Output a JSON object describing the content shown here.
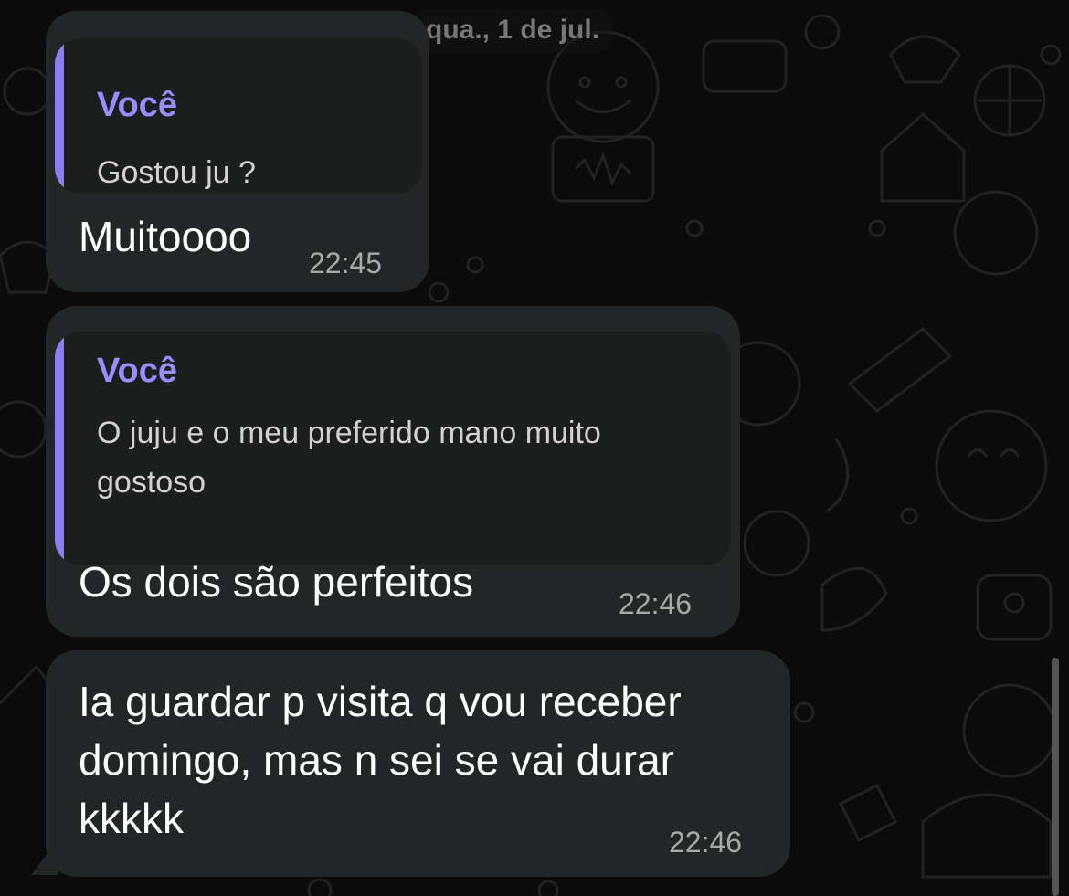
{
  "date_chip": "qua., 1 de jul.",
  "accent_color": "#9d8cff",
  "messages": [
    {
      "quote": {
        "author": "Você",
        "text": "Gostou ju ?"
      },
      "text": "Muitoooo",
      "time": "22:45"
    },
    {
      "quote": {
        "author": "Você",
        "text": "O juju e o meu preferido mano muito gostoso"
      },
      "text": "Os dois são perfeitos",
      "time": "22:46"
    },
    {
      "text": "Ia guardar p visita q vou receber domingo, mas n sei se vai durar kkkkk",
      "time": "22:46"
    }
  ]
}
